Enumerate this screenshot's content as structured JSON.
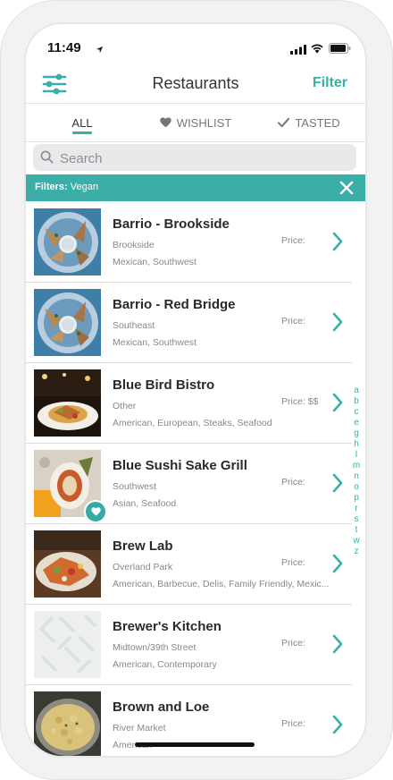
{
  "status_bar": {
    "time": "11:49"
  },
  "header": {
    "title": "Restaurants",
    "filter_label": "Filter",
    "menu_icon": "sliders-icon"
  },
  "tabs": [
    {
      "label": "ALL",
      "icon": "",
      "active": true
    },
    {
      "label": "WISHLIST",
      "icon": "heart-icon",
      "active": false
    },
    {
      "label": "TASTED",
      "icon": "check-icon",
      "active": false
    }
  ],
  "search": {
    "placeholder": "Search"
  },
  "filter_bar": {
    "prefix": "Filters:",
    "value": "Vegan"
  },
  "restaurants": [
    {
      "name": "Barrio - Brookside",
      "area": "Brookside",
      "cuisine": "Mexican, Southwest",
      "price": "Price:",
      "wishlisted": false
    },
    {
      "name": "Barrio - Red Bridge",
      "area": "Southeast",
      "cuisine": "Mexican, Southwest",
      "price": "Price:",
      "wishlisted": false
    },
    {
      "name": "Blue Bird Bistro",
      "area": "Other",
      "cuisine": "American, European, Steaks, Seafood",
      "price": "Price: $$",
      "wishlisted": false
    },
    {
      "name": "Blue Sushi Sake Grill",
      "area": "Southwest",
      "cuisine": "Asian, Seafood",
      "price": "Price:",
      "wishlisted": true
    },
    {
      "name": "Brew Lab",
      "area": "Overland Park",
      "cuisine": "American, Barbecue, Delis, Family Friendly, Mexic...",
      "price": "Price:",
      "wishlisted": false
    },
    {
      "name": "Brewer's Kitchen",
      "area": "Midtown/39th Street",
      "cuisine": "American, Contemporary",
      "price": "Price:",
      "wishlisted": false
    },
    {
      "name": "Brown and Loe",
      "area": "River Market",
      "cuisine": "American",
      "price": "Price:",
      "wishlisted": false
    }
  ],
  "alpha_index": [
    "a",
    "b",
    "c",
    "e",
    "g",
    "h",
    "l",
    "m",
    "n",
    "o",
    "p",
    "r",
    "s",
    "t",
    "w",
    "z"
  ],
  "colors": {
    "accent": "#37b0a8",
    "filter_bar": "#3aaea7"
  }
}
